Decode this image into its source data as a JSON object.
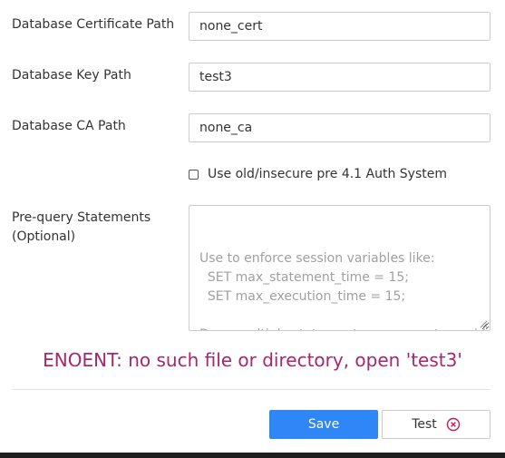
{
  "form": {
    "cert_path": {
      "label": "Database Certificate Path",
      "value": "none_cert"
    },
    "key_path": {
      "label": "Database Key Path",
      "value": "test3"
    },
    "ca_path": {
      "label": "Database CA Path",
      "value": "none_ca"
    },
    "old_auth": {
      "label": "Use old/insecure pre 4.1 Auth System",
      "checked": false
    },
    "pre_query": {
      "label_line1": "Pre-query Statements",
      "label_line2": "(Optional)",
      "placeholder": "Use to enforce session variables like:\n  SET max_statement_time = 15;\n  SET max_execution_time = 15;\n\nDeny multiple statements per query to avoid\noverwritten values."
    }
  },
  "error_message": "ENOENT: no such file or directory, open 'test3'",
  "actions": {
    "save_label": "Save",
    "test_label": "Test"
  },
  "colors": {
    "error": "#a6276b",
    "primary": "#2f86f6",
    "test_icon": "#c2185b"
  },
  "icons": {
    "test": "close-circle-icon",
    "checkbox": "checkbox-unchecked-icon",
    "resize": "resize-grip-icon"
  }
}
